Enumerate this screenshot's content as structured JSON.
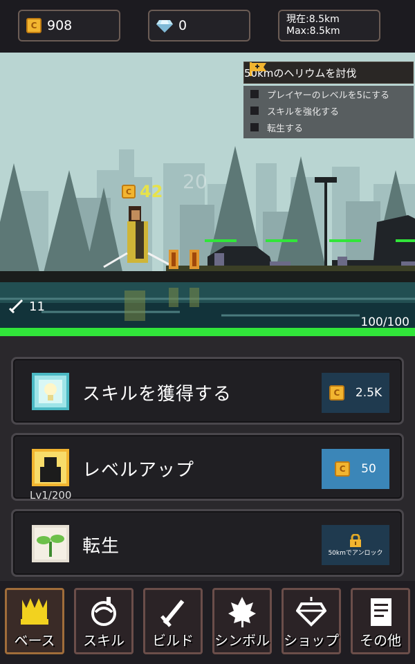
{
  "topbar": {
    "coins": "908",
    "gems": "0",
    "current_distance": "現在:8.5km",
    "max_distance": "Max:8.5km"
  },
  "quest": {
    "title": "50kmのヘリウムを討伐",
    "items": [
      "プレイヤーのレベルを5にする",
      "スキルを強化する",
      "転生する"
    ]
  },
  "battle": {
    "damage_popup": "42",
    "faded_popup": "20",
    "attack_power": "11",
    "hp_text": "100/100",
    "hp_fraction": 1.0
  },
  "actions": [
    {
      "label": "スキルを獲得する",
      "price": "2.5K",
      "icon": "skill-crystal-icon"
    },
    {
      "label": "レベルアップ",
      "price": "50",
      "level": "Lv1/200",
      "icon": "player-silhouette-icon"
    },
    {
      "label": "転生",
      "lock_text": "50kmでアンロック",
      "icon": "sprout-icon"
    }
  ],
  "nav": {
    "tabs": [
      "ベース",
      "スキル",
      "ビルド",
      "シンボル",
      "ショップ",
      "その他"
    ],
    "active": "ベース"
  },
  "colors": {
    "hp_bar": "#31e53a",
    "coin": "#f2b530",
    "price_active": "#3b86b8",
    "price_inactive": "#1f3a4f",
    "damage_text": "#e7e24a"
  }
}
